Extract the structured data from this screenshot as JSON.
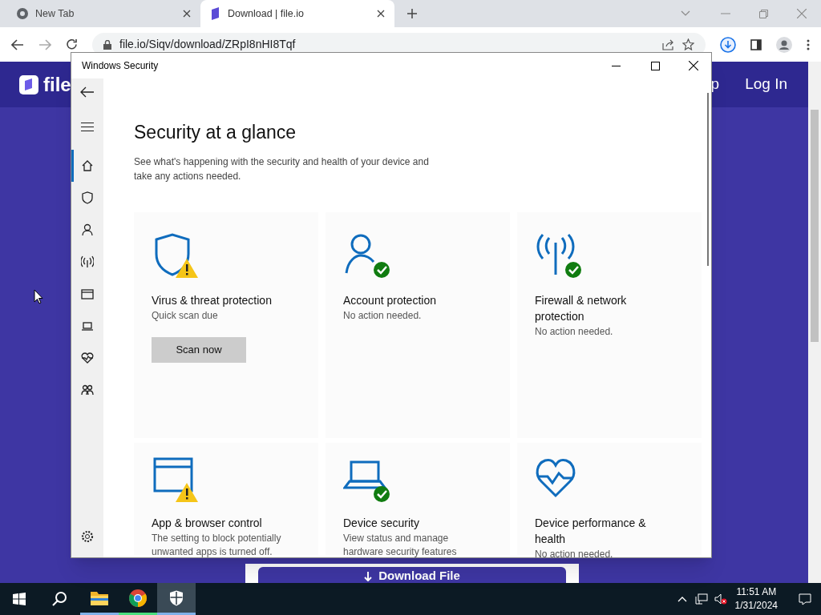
{
  "browser": {
    "tabs": [
      {
        "title": "New Tab",
        "selected": false
      },
      {
        "title": "Download | file.io",
        "selected": true
      }
    ],
    "address": "file.io/Siqv/download/ZRpI8nHI8Tqf"
  },
  "page": {
    "logo": "file",
    "nav_partial": "p",
    "login": "Log In",
    "download_button": "Download File"
  },
  "window": {
    "title": "Windows Security",
    "nav": [
      {
        "kind": "home",
        "selected": true
      },
      {
        "kind": "shield",
        "selected": false
      },
      {
        "kind": "person",
        "selected": false
      },
      {
        "kind": "antenna",
        "selected": false
      },
      {
        "kind": "browser",
        "selected": false
      },
      {
        "kind": "laptop",
        "selected": false
      },
      {
        "kind": "heart",
        "selected": false
      },
      {
        "kind": "family",
        "selected": false
      }
    ],
    "heading": "Security at a glance",
    "description": "See what's happening with the security and health of your device and take any actions needed.",
    "cards": [
      {
        "kind": "shield",
        "warning": true,
        "ok": false,
        "title": "Virus & threat protection",
        "detail": "Quick scan due",
        "button": "Scan now"
      },
      {
        "kind": "person",
        "warning": false,
        "ok": true,
        "title": "Account protection",
        "detail": "No action needed."
      },
      {
        "kind": "antenna",
        "warning": false,
        "ok": true,
        "title": "Firewall & network protection",
        "detail": "No action needed."
      },
      {
        "kind": "browser",
        "warning": true,
        "ok": false,
        "title": "App & browser control",
        "detail": "The setting to block potentially unwanted apps is turned off."
      },
      {
        "kind": "laptop",
        "warning": false,
        "ok": true,
        "title": "Device security",
        "detail": "View status and manage hardware security features"
      },
      {
        "kind": "heart",
        "warning": false,
        "ok": false,
        "title": "Device performance & health",
        "detail": "No action needed."
      }
    ]
  },
  "taskbar": {
    "apps": [
      {
        "kind": "files",
        "running": true,
        "selected": false
      },
      {
        "kind": "chrome",
        "running": true,
        "selected": false
      },
      {
        "kind": "security",
        "running": true,
        "selected": true
      }
    ],
    "time": "11:51 AM",
    "date": "1/31/2024"
  }
}
